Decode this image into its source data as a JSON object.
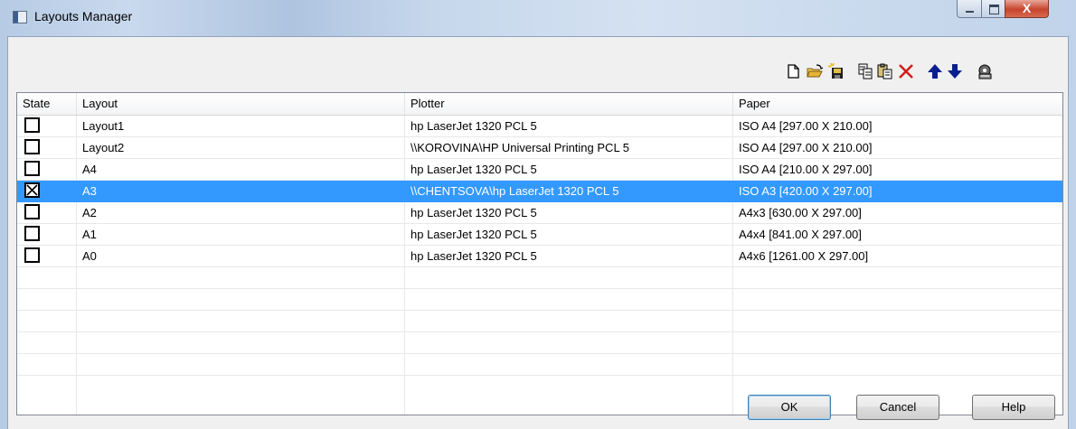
{
  "window": {
    "title": "Layouts Manager",
    "close_glyph": "X"
  },
  "toolbar": {
    "icons": [
      "new-icon",
      "open-icon",
      "save-new-icon",
      "copy-icon",
      "paste-icon",
      "delete-icon",
      "move-up-icon",
      "move-down-icon",
      "settings-icon"
    ],
    "colors": {
      "arrow": "#0a1f8f",
      "delete": "#d21f1f"
    }
  },
  "table": {
    "headers": {
      "state": "State",
      "layout": "Layout",
      "plotter": "Plotter",
      "paper": "Paper"
    },
    "rows": [
      {
        "checked": false,
        "layout": "Layout1",
        "plotter": "hp LaserJet 1320 PCL 5",
        "paper": "ISO A4 [297.00 X 210.00]"
      },
      {
        "checked": false,
        "layout": "Layout2",
        "plotter": "\\\\KOROVINA\\HP Universal Printing PCL 5",
        "paper": "ISO A4 [297.00 X 210.00]"
      },
      {
        "checked": false,
        "layout": "A4",
        "plotter": "hp LaserJet 1320 PCL 5",
        "paper": "ISO A4 [210.00 X 297.00]"
      },
      {
        "checked": true,
        "selected": true,
        "layout": "A3",
        "plotter": "\\\\CHENTSOVA\\hp LaserJet 1320 PCL 5",
        "paper": "ISO A3 [420.00 X 297.00]"
      },
      {
        "checked": false,
        "layout": "A2",
        "plotter": "hp LaserJet 1320 PCL 5",
        "paper": "A4x3 [630.00 X 297.00]"
      },
      {
        "checked": false,
        "layout": "A1",
        "plotter": "hp LaserJet 1320 PCL 5",
        "paper": "A4x4 [841.00 X 297.00]"
      },
      {
        "checked": false,
        "layout": "A0",
        "plotter": "hp LaserJet 1320 PCL 5",
        "paper": "A4x6 [1261.00 X 297.00]"
      }
    ],
    "empty_rows": 5,
    "selection_color": "#3399ff"
  },
  "buttons": {
    "ok": "OK",
    "cancel": "Cancel",
    "help": "Help"
  }
}
